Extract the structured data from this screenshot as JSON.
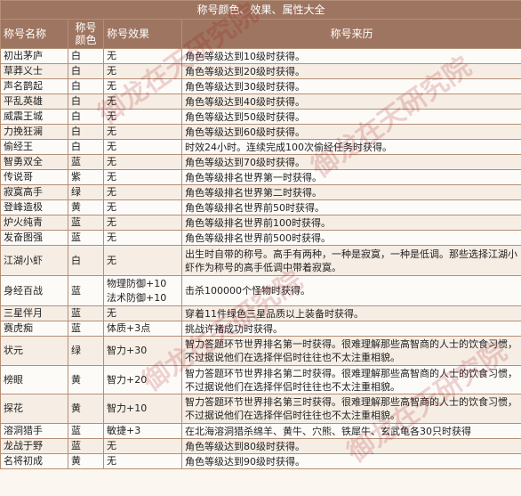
{
  "title": "称号颜色、效果、属性大全",
  "headers": [
    "称号名称",
    "称号颜色",
    "称号效果",
    "称号来历"
  ],
  "watermark": "御龙在天研究院",
  "rows": [
    {
      "name": "初出茅庐",
      "color": "白",
      "effect": "无",
      "source": "角色等级达到10级时获得。"
    },
    {
      "name": "草莽义士",
      "color": "白",
      "effect": "无",
      "source": "角色等级达到20级时获得。"
    },
    {
      "name": "声名鹊起",
      "color": "白",
      "effect": "无",
      "source": "角色等级达到30级时获得。"
    },
    {
      "name": "平乱英雄",
      "color": "白",
      "effect": "无",
      "source": "角色等级达到40级时获得。"
    },
    {
      "name": "威震王城",
      "color": "白",
      "effect": "无",
      "source": "角色等级达到50级时获得。"
    },
    {
      "name": "力挽狂澜",
      "color": "白",
      "effect": "无",
      "source": "角色等级达到60级时获得。"
    },
    {
      "name": "偷经王",
      "color": "白",
      "effect": "无",
      "source": "时效24小时。连续完成100次偷经任务时获得。"
    },
    {
      "name": "智勇双全",
      "color": "蓝",
      "effect": "无",
      "source": "角色等级达到70级时获得。"
    },
    {
      "name": "传说哥",
      "color": "紫",
      "effect": "无",
      "source": "角色等级排名世界第一时获得。"
    },
    {
      "name": "寂寞高手",
      "color": "绿",
      "effect": "无",
      "source": "角色等级排名世界第二时获得。"
    },
    {
      "name": "登峰造极",
      "color": "黄",
      "effect": "无",
      "source": "角色等级排名世界前50时获得。"
    },
    {
      "name": "炉火纯青",
      "color": "蓝",
      "effect": "无",
      "source": "角色等级排名世界前100时获得。"
    },
    {
      "name": "发奋图强",
      "color": "蓝",
      "effect": "无",
      "source": "角色等级排名世界前500时获得。"
    },
    {
      "name": "江湖小虾",
      "color": "白",
      "effect": "无",
      "source": "出生时自带的称号。高手有两种，一种是寂寞，一种是低调。那些选择江湖小虾作为称号的高手低调中带着寂寞。"
    },
    {
      "name": "身经百战",
      "color": "蓝",
      "effect": "物理防御+10\n法术防御+10",
      "source": "击杀100000个怪物时获得。"
    },
    {
      "name": "三星伴月",
      "color": "蓝",
      "effect": "无",
      "source": "穿着11件绿色三星品质以上装备时获得。"
    },
    {
      "name": "赛虎痴",
      "color": "蓝",
      "effect": "体质+3点",
      "source": "挑战许褚成功时获得。"
    },
    {
      "name": "状元",
      "color": "绿",
      "effect": "智力+30",
      "source": "智力答题环节世界排名第一时获得。很难理解那些高智商的人士的饮食习惯，不过据说他们在选择伴侣时往往也不太注重相貌。"
    },
    {
      "name": "榜眼",
      "color": "黄",
      "effect": "智力+20",
      "source": "智力答题环节世界排名第二时获得。很难理解那些高智商的人士的饮食习惯，不过据说他们在选择伴侣时往往也不太注重相貌。"
    },
    {
      "name": "探花",
      "color": "黄",
      "effect": "智力+10",
      "source": "智力答题环节世界排名第三时获得。很难理解那些高智商的人士的饮食习惯，不过据说他们在选择伴侣时往往也不太注重相貌。"
    },
    {
      "name": "溶洞猎手",
      "color": "蓝",
      "effect": "敏捷+3",
      "source": "在北海溶洞猎杀绵羊、黄牛、穴熊、铁犀牛、玄武龟各30只时获得"
    },
    {
      "name": "龙战于野",
      "color": "蓝",
      "effect": "无",
      "source": "角色等级达到80级时获得。"
    },
    {
      "name": "名将初成",
      "color": "黄",
      "effect": "无",
      "source": "角色等级达到90级时获得。"
    }
  ]
}
